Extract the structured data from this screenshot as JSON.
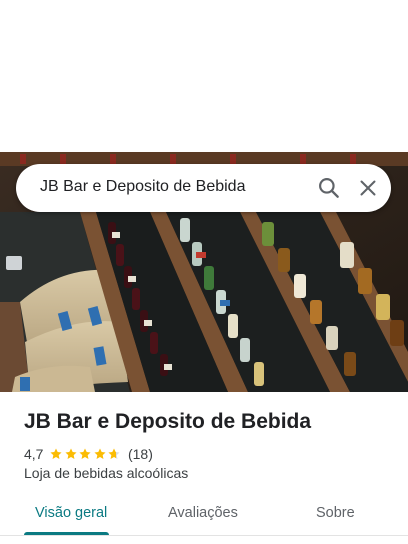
{
  "search": {
    "query": "JB Bar e Deposito de Bebida"
  },
  "place": {
    "name": "JB Bar e Deposito de Bebida",
    "rating": "4,7",
    "rating_fraction": 0.94,
    "review_count": "(18)",
    "category": "Loja de bebidas alcoólicas"
  },
  "tabs": [
    {
      "label": "Visão geral",
      "active": true
    },
    {
      "label": "Avaliações",
      "active": false
    },
    {
      "label": "Sobre",
      "active": false
    }
  ],
  "colors": {
    "accent": "#0b7a82",
    "star": "#fbbc04",
    "text": "#202124",
    "muted": "#3c4043"
  },
  "icons": {
    "search": "search-icon",
    "close": "close-icon",
    "star": "star-icon"
  }
}
